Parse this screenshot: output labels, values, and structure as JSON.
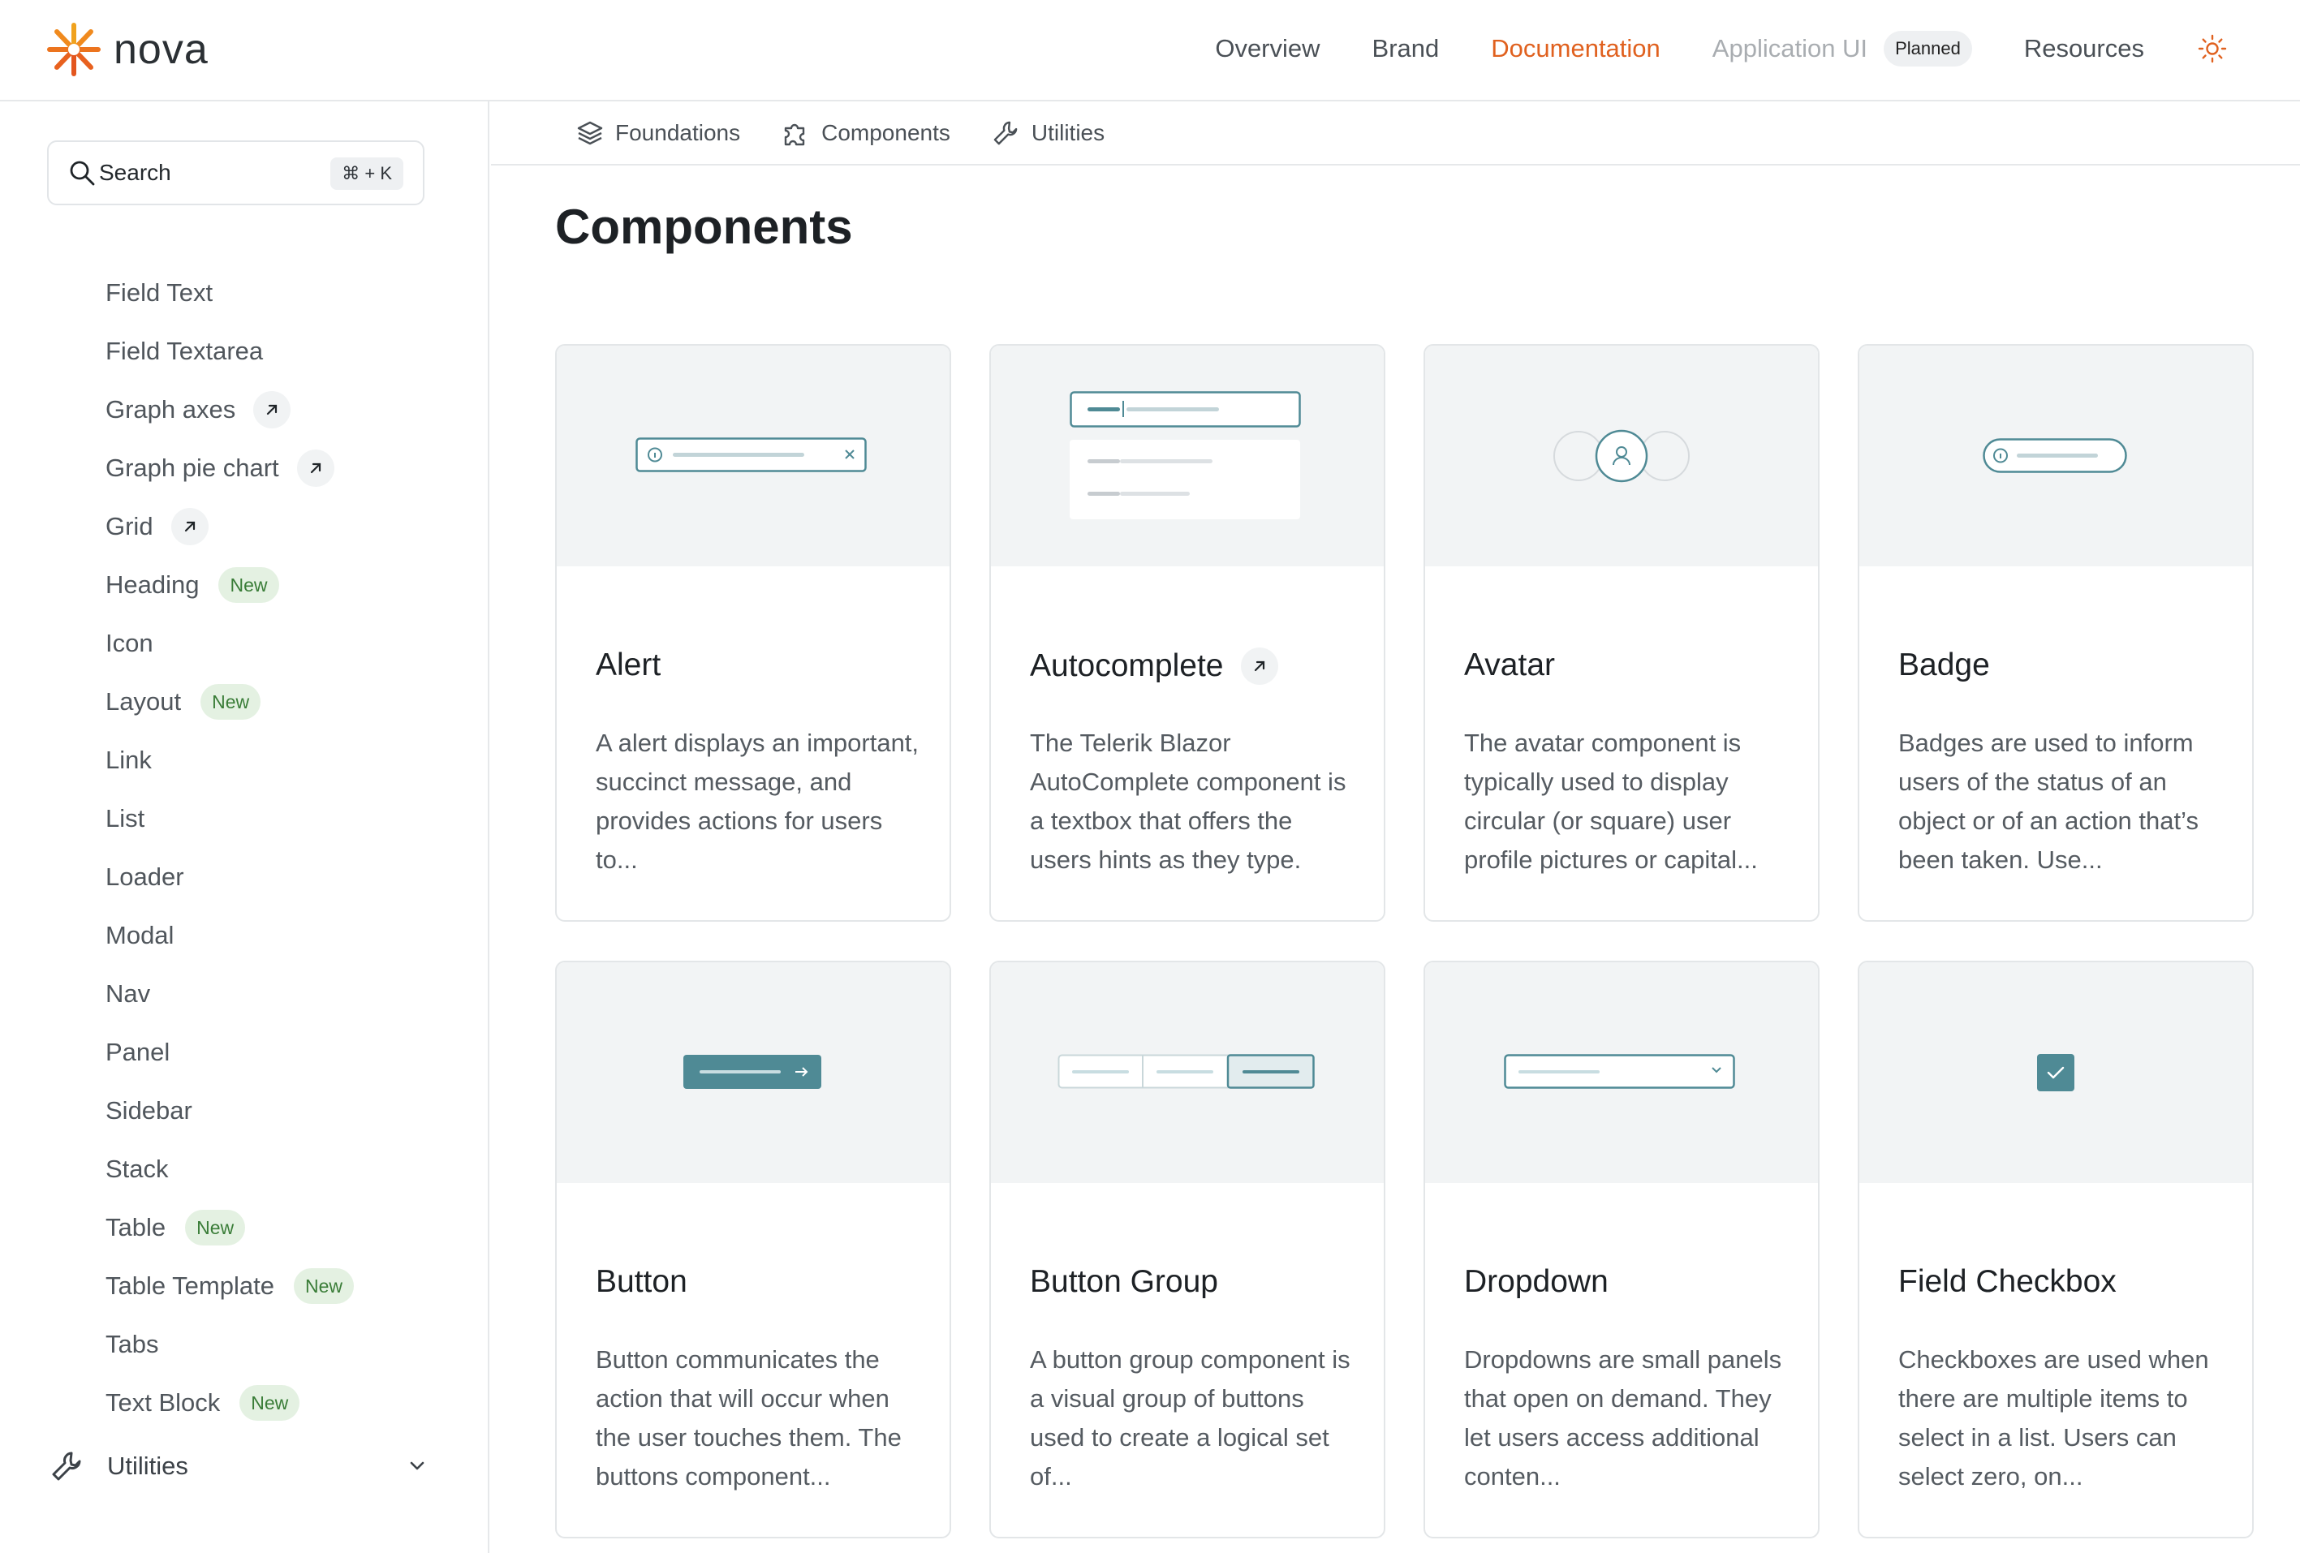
{
  "header": {
    "logo_text": "nova",
    "nav": [
      {
        "label": "Overview"
      },
      {
        "label": "Brand"
      },
      {
        "label": "Documentation"
      },
      {
        "label": "Application UI"
      },
      {
        "label": "Resources"
      }
    ],
    "planned_badge": "Planned",
    "accent_color": "#e0611f"
  },
  "sidebar": {
    "search_label": "Search",
    "search_shortcut": "⌘ + K",
    "items": [
      {
        "label": "Field Text"
      },
      {
        "label": "Field Textarea"
      },
      {
        "label": "Graph axes"
      },
      {
        "label": "Graph pie chart"
      },
      {
        "label": "Grid"
      },
      {
        "label": "Heading",
        "badge": "New"
      },
      {
        "label": "Icon"
      },
      {
        "label": "Layout",
        "badge": "New"
      },
      {
        "label": "Link"
      },
      {
        "label": "List"
      },
      {
        "label": "Loader"
      },
      {
        "label": "Modal"
      },
      {
        "label": "Nav"
      },
      {
        "label": "Panel"
      },
      {
        "label": "Sidebar"
      },
      {
        "label": "Stack"
      },
      {
        "label": "Table",
        "badge": "New"
      },
      {
        "label": "Table Template",
        "badge": "New"
      },
      {
        "label": "Tabs"
      },
      {
        "label": "Text Block",
        "badge": "New"
      }
    ],
    "utilities_label": "Utilities"
  },
  "subtabs": [
    {
      "label": "Foundations"
    },
    {
      "label": "Components"
    },
    {
      "label": "Utilities"
    }
  ],
  "main": {
    "title": "Components",
    "cards": [
      {
        "title": "Alert",
        "desc": "A alert displays an important, succinct message, and provides actions for users to..."
      },
      {
        "title": "Autocomplete",
        "desc": "The Telerik Blazor AutoComplete component is a textbox that offers the users hints as they type."
      },
      {
        "title": "Avatar",
        "desc": "The avatar component is typically used to display circular (or square) user profile pictures or capital..."
      },
      {
        "title": "Badge",
        "desc": "Badges are used to inform users of the status of an object or of an action that’s been taken. Use..."
      },
      {
        "title": "Button",
        "desc": "Button communicates the action that will occur when the user touches them. The buttons component..."
      },
      {
        "title": "Button Group",
        "desc": "A button group component is a visual group of buttons used to create a logical set of..."
      },
      {
        "title": "Dropdown",
        "desc": "Dropdowns are small panels that open on demand. They let users access additional conten..."
      },
      {
        "title": "Field Checkbox",
        "desc": "Checkboxes are used when there are multiple items to select in a list. Users can select zero, on..."
      }
    ]
  },
  "colors": {
    "preview_accent": "#4f8a95",
    "new_badge_bg": "#e4f1e2",
    "new_badge_text": "#3a7d38"
  }
}
